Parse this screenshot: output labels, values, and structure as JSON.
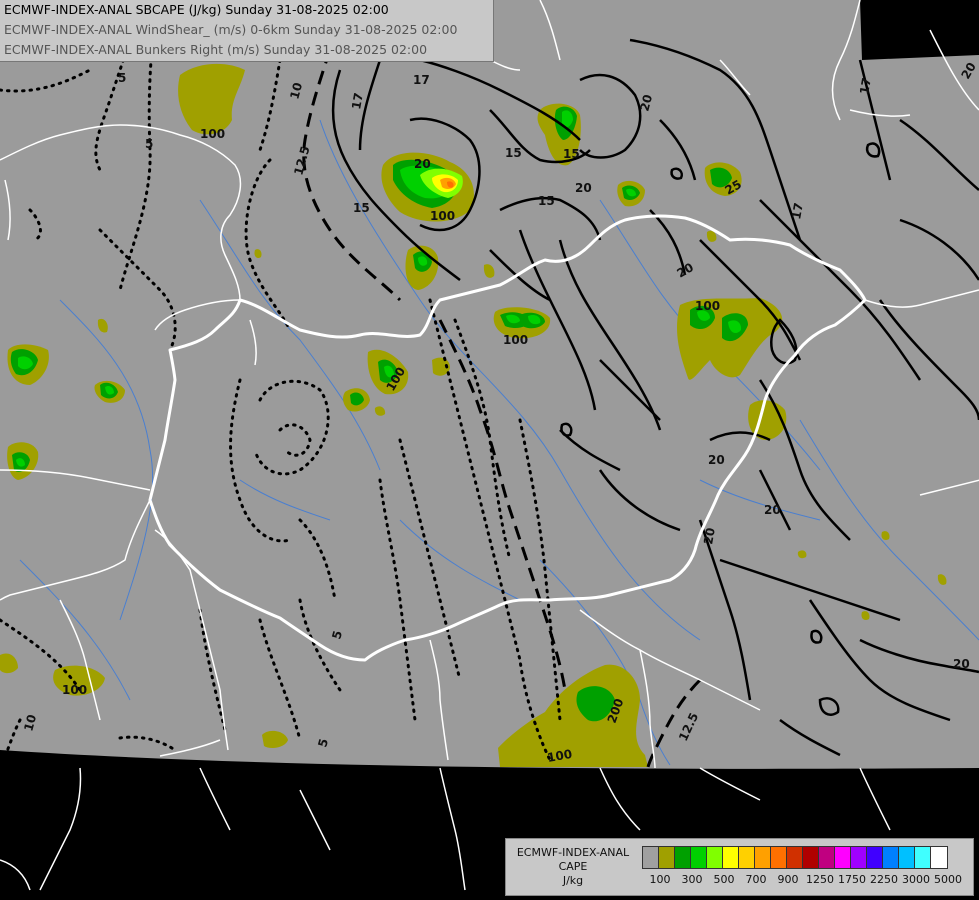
{
  "title_lines": [
    "ECMWF-INDEX-ANAL SBCAPE (J/kg) Sunday 31-08-2025 02:00",
    "ECMWF-INDEX-ANAL WindShear_ (m/s) 0-6km Sunday 31-08-2025 02:00",
    "ECMWF-INDEX-ANAL Bunkers Right (m/s) Sunday 31-08-2025 02:00"
  ],
  "legend": {
    "label_line1": "ECMWF-INDEX-ANAL",
    "label_line2": "CAPE",
    "label_line3": "J/kg",
    "colors": [
      "#a0a0a0",
      "#a0a000",
      "#00a000",
      "#00d000",
      "#80ff00",
      "#ffff00",
      "#ffd000",
      "#ffa000",
      "#ff7000",
      "#d03000",
      "#b00000",
      "#c00080",
      "#ff00ff",
      "#a000ff",
      "#4000ff",
      "#0080ff",
      "#00c0ff",
      "#40ffff",
      "#ffffff"
    ],
    "ticks": [
      "100",
      "300",
      "500",
      "700",
      "900",
      "1250",
      "1750",
      "2250",
      "3000",
      "5000"
    ]
  },
  "contour_labels": {
    "dotted": [
      "5",
      "5",
      "10",
      "12.5",
      "5",
      "10",
      "5"
    ],
    "dashed": [
      "12.5",
      "12.5"
    ],
    "solid": [
      "17",
      "17",
      "17",
      "20",
      "15",
      "15",
      "20",
      "20",
      "15",
      "15",
      "20",
      "20",
      "17",
      "20",
      "20",
      "20",
      "20",
      "25"
    ],
    "cape": [
      "100",
      "100",
      "100",
      "100",
      "100",
      "100",
      "100",
      "100",
      "100",
      "100",
      "200"
    ]
  },
  "colors": {
    "map_gray": "#9b9b9b",
    "outside": "#000000",
    "border": "#ffffff",
    "river": "#4a7fd0",
    "cape_100": "#a0a000",
    "cape_300": "#00a000",
    "cape_500": "#00d000",
    "cape_700": "#ffff00",
    "cape_900": "#ffa000"
  }
}
